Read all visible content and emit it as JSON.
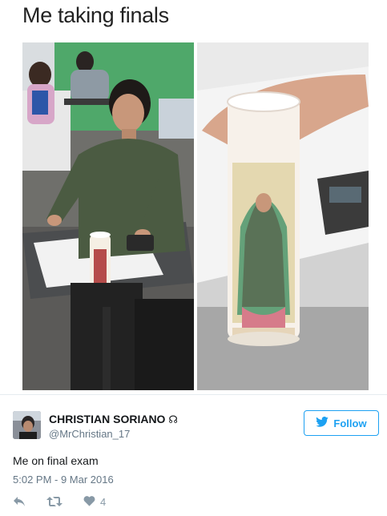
{
  "meme": {
    "caption": "Me taking finals"
  },
  "tweet": {
    "author_name": "CHRISTIAN SORIANO",
    "author_badge": "☊",
    "author_handle": "@MrChristian_17",
    "follow_label": "Follow",
    "text": "Me on final exam",
    "timestamp": "5:02 PM - 9 Mar 2016",
    "like_count": "4"
  },
  "colors": {
    "accent": "#1da1f2",
    "muted": "#657786",
    "icon": "#8899a6"
  },
  "icons": [
    "twitter-bird-icon",
    "reply-icon",
    "retweet-icon",
    "heart-icon"
  ]
}
